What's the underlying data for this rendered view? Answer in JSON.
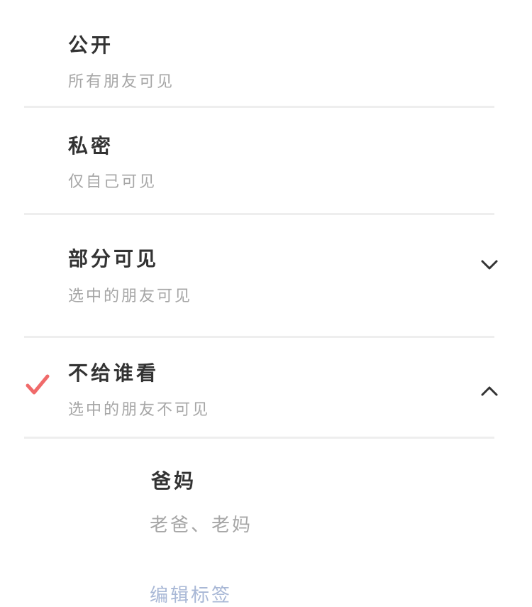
{
  "options": [
    {
      "title": "公开",
      "subtitle": "所有朋友可见"
    },
    {
      "title": "私密",
      "subtitle": "仅自己可见"
    },
    {
      "title": "部分可见",
      "subtitle": "选中的朋友可见"
    },
    {
      "title": "不给谁看",
      "subtitle": "选中的朋友不可见"
    }
  ],
  "selected_option": "不给谁看",
  "tag_group": {
    "name": "爸妈",
    "members": "老爸、老妈"
  },
  "edit_tags_label": "编辑标签",
  "colors": {
    "check": "#f06a6a",
    "title": "#333333",
    "subtitle": "#a6a6a6",
    "edit_link": "#a9b8d6",
    "divider": "#eeeeee"
  },
  "icons": {
    "selected": "checkmark-icon",
    "collapsed": "chevron-down-icon",
    "expanded": "chevron-up-icon"
  }
}
